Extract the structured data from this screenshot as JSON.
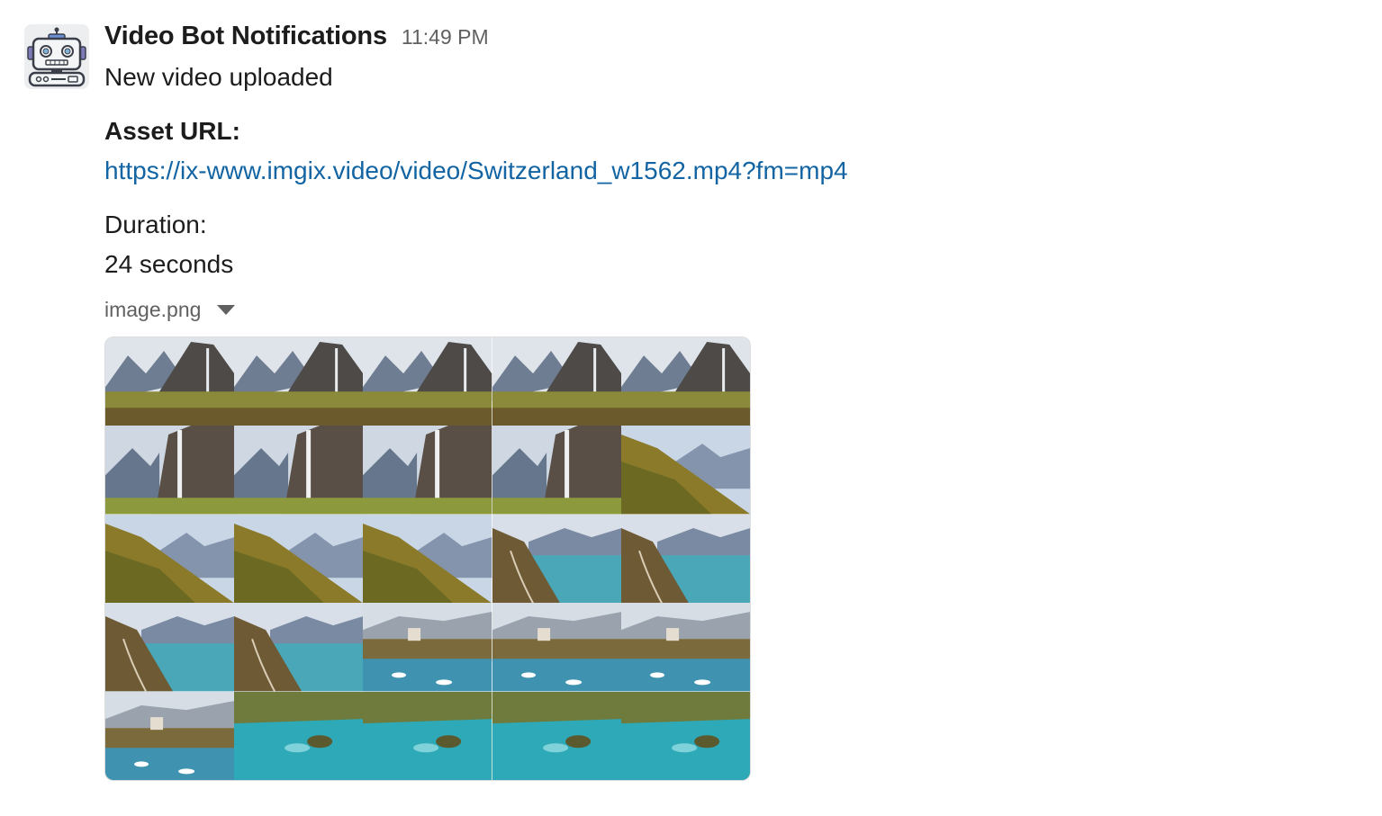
{
  "message": {
    "sender": "Video Bot Notifications",
    "timestamp": "11:49 PM",
    "text": "New video uploaded",
    "asset_label": "Asset URL:",
    "asset_url": "https://ix-www.imgix.video/video/Switzerland_w1562.mp4?fm=mp4",
    "duration_label": "Duration:",
    "duration_value": "24 seconds",
    "attachment": {
      "file_name": "image.png",
      "icon": "chevron-down-icon",
      "frames": [
        "waterfall-cliff",
        "waterfall-cliff",
        "waterfall-cliff",
        "waterfall-cliff",
        "waterfall-cliff",
        "waterfall-close",
        "waterfall-close",
        "waterfall-close",
        "waterfall-close",
        "forest-slope",
        "forest-slope",
        "forest-slope",
        "forest-slope",
        "lake-road",
        "lake-road",
        "lake-road",
        "lake-road",
        "lakeside-castle",
        "lakeside-castle",
        "lakeside-castle",
        "lakeside-castle",
        "turquoise-island",
        "turquoise-island",
        "turquoise-island",
        "turquoise-island"
      ]
    }
  },
  "colors": {
    "link": "#1264a3",
    "muted": "#616061",
    "text": "#1d1c1d"
  }
}
